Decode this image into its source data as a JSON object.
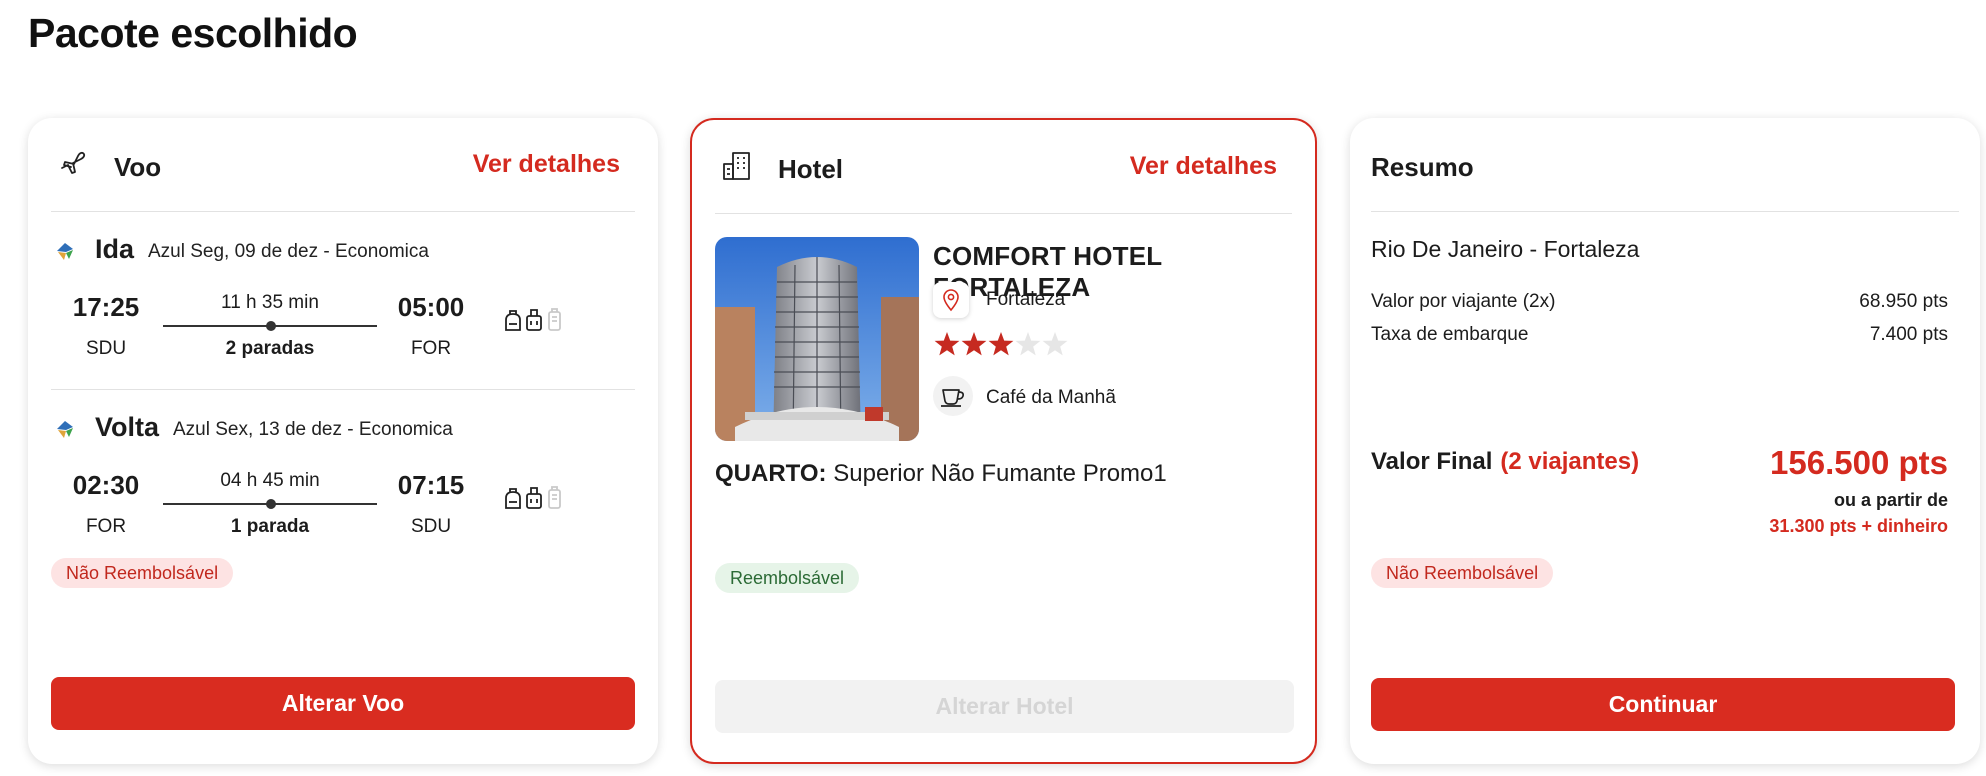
{
  "page_title": "Pacote escolhido",
  "flight": {
    "title": "Voo",
    "details_link": "Ver detalhes",
    "legs": [
      {
        "name": "Ida",
        "info": "Azul Seg, 09 de dez - Economica",
        "dep_time": "17:25",
        "arr_time": "05:00",
        "duration": "11 h 35 min",
        "stops": "2 paradas",
        "dep_code": "SDU",
        "arr_code": "FOR"
      },
      {
        "name": "Volta",
        "info": "Azul Sex, 13 de dez - Economica",
        "dep_time": "02:30",
        "arr_time": "07:15",
        "duration": "04 h 45 min",
        "stops": "1 parada",
        "dep_code": "FOR",
        "arr_code": "SDU"
      }
    ],
    "refund_badge": "Não Reembolsável",
    "change_button": "Alterar Voo"
  },
  "hotel": {
    "title": "Hotel",
    "details_link": "Ver detalhes",
    "name": "COMFORT HOTEL FORTALEZA",
    "city": "Fortaleza",
    "stars_filled": 3,
    "stars_total": 5,
    "amenity": "Café da Manhã",
    "room_label": "QUARTO:",
    "room_value": "Superior Não Fumante Promo1",
    "refund_badge": "Reembolsável",
    "change_button": "Alterar Hotel"
  },
  "summary": {
    "title": "Resumo",
    "route": "Rio De Janeiro - Fortaleza",
    "rows": [
      {
        "label": "Valor por viajante (2x)",
        "value": "68.950 pts"
      },
      {
        "label": "Taxa de embarque",
        "value": "7.400 pts"
      }
    ],
    "final_label": "Valor Final",
    "final_travelers": "(2 viajantes)",
    "final_value": "156.500 pts",
    "or_text": "ou a partir de",
    "or_value": "31.300 pts + dinheiro",
    "refund_badge": "Não Reembolsável",
    "continue_button": "Continuar"
  },
  "colors": {
    "accent": "#d92c20",
    "star_filled": "#c62a20",
    "star_empty": "#e6e6e6"
  },
  "icons": [
    "airplane-icon",
    "building-icon",
    "map-pin-icon",
    "coffee-cup-icon",
    "backpack-icon",
    "carry-on-icon",
    "checked-bag-icon",
    "star-icon",
    "airline-logo"
  ]
}
